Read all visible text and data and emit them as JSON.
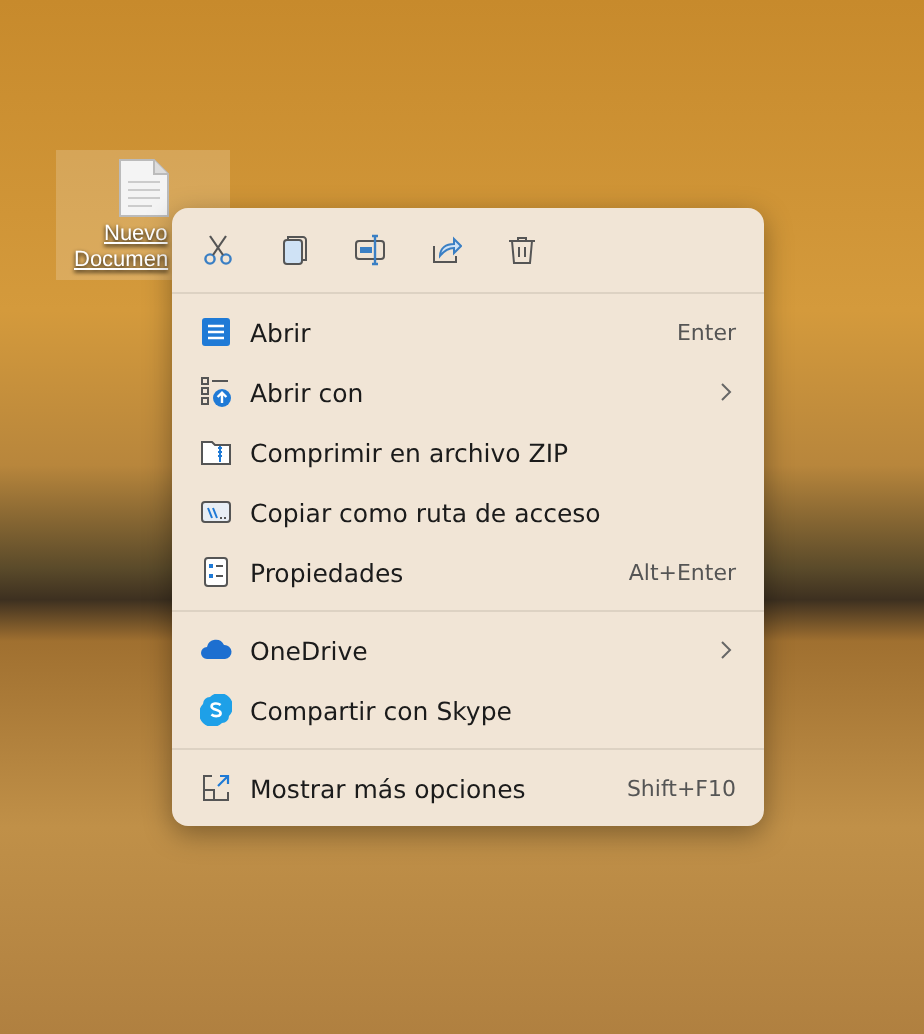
{
  "desktop_icon": {
    "label_lines": [
      "Nuevo",
      "Documen"
    ],
    "selected": true
  },
  "context_menu": {
    "toolbar": [
      {
        "kind": "cut"
      },
      {
        "kind": "copy"
      },
      {
        "kind": "rename"
      },
      {
        "kind": "share"
      },
      {
        "kind": "delete"
      }
    ],
    "groups": [
      [
        {
          "kind": "open",
          "label": "Abrir",
          "shortcut": "Enter",
          "submenu": false
        },
        {
          "kind": "openwith",
          "label": "Abrir con",
          "submenu": true
        },
        {
          "kind": "zip",
          "label": "Comprimir en archivo ZIP",
          "submenu": false
        },
        {
          "kind": "path",
          "label": "Copiar como ruta de acceso",
          "submenu": false
        },
        {
          "kind": "props",
          "label": "Propiedades",
          "shortcut": "Alt+Enter",
          "submenu": false
        }
      ],
      [
        {
          "kind": "cloud",
          "label": "OneDrive",
          "submenu": true
        },
        {
          "kind": "skype",
          "label": "Compartir con Skype",
          "submenu": false
        }
      ],
      [
        {
          "kind": "more",
          "label": "Mostrar más opciones",
          "shortcut": "Shift+F10",
          "submenu": false
        }
      ]
    ]
  }
}
